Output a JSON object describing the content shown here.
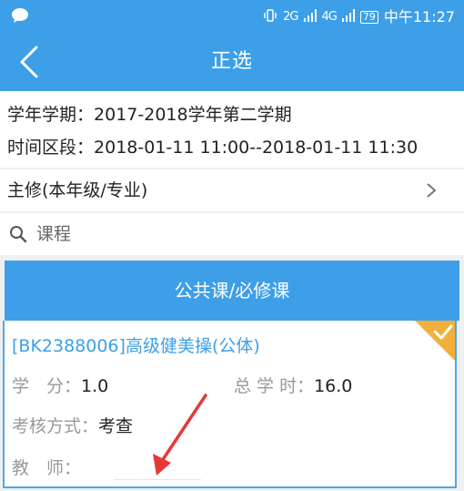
{
  "status_bar": {
    "network_2g": "2G",
    "network_4g": "4G",
    "battery": "79",
    "time": "中午11:27"
  },
  "header": {
    "title": "正选"
  },
  "info": {
    "term_label": "学年学期：",
    "term_value": "2017-2018学年第二学期",
    "period_label": "时间区段：",
    "period_value": "2018-01-11 11:00--2018-01-11 11:30"
  },
  "filter": {
    "major_label": "主修(本年级/专业)"
  },
  "search": {
    "placeholder": "课程"
  },
  "section": {
    "title": "公共课/必修课"
  },
  "course": {
    "title": "[BK2388006]高级健美操(公体)",
    "credit_label": "学　分：",
    "credit_value": "1.0",
    "hours_label": "总 学 时：",
    "hours_value": "16.0",
    "assess_label": "考核方式：",
    "assess_value": "考查",
    "teacher_label": "教　师：",
    "teacher_value": "",
    "selected": true
  },
  "colors": {
    "accent": "#3d9fe8",
    "check": "#f1b03a",
    "annotation": "#e53935"
  },
  "icons": [
    "chat-icon",
    "back-arrow-icon",
    "chevron-right-icon",
    "search-icon",
    "checkmark-icon"
  ]
}
